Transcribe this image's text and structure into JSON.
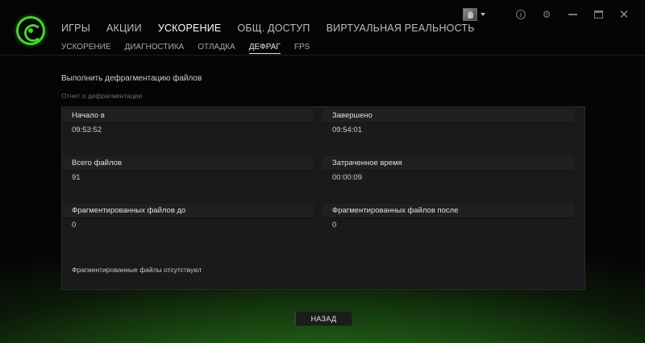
{
  "nav": {
    "main": [
      "ИГРЫ",
      "АКЦИИ",
      "УСКОРЕНИЕ",
      "ОБЩ. ДОСТУП",
      "ВИРТУАЛЬНАЯ РЕАЛЬНОСТЬ"
    ],
    "main_active": "УСКОРЕНИЕ",
    "sub": [
      "УСКОРЕНИЕ",
      "ДИАГНОСТИКА",
      "ОТЛАДКА",
      "ДЕФРАГ",
      "FPS"
    ],
    "sub_active": "ДЕФРАГ"
  },
  "window": {
    "icons": [
      "user-avatar",
      "info-icon",
      "gear-icon",
      "minimize-icon",
      "maximize-icon",
      "close-icon"
    ]
  },
  "page": {
    "title": "Выполнить дефрагментацию файлов",
    "section_label": "Отчет о дефрагментации"
  },
  "report": {
    "start_label": "Начало в",
    "start_value": "09:53:52",
    "end_label": "Завершено",
    "end_value": "09:54:01",
    "total_files_label": "Всего файлов",
    "total_files_value": "91",
    "elapsed_label": "Затраченное время",
    "elapsed_value": "00:00:09",
    "frag_before_label": "Фрагментированных файлов до",
    "frag_before_value": "0",
    "frag_after_label": "Фрагментированных файлов после",
    "frag_after_value": "0",
    "note": "Фрагментированные файлы отсутствуют"
  },
  "buttons": {
    "back": "НАЗАД"
  },
  "colors": {
    "accent": "#44d62c",
    "background": "#050505",
    "panel": "#1a1a1a"
  }
}
